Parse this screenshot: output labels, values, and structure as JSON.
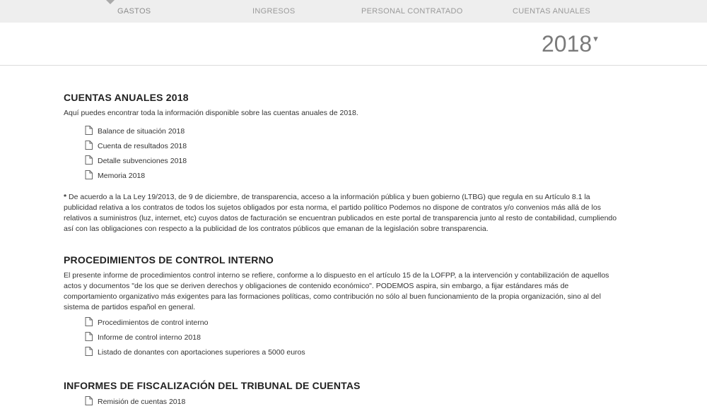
{
  "nav": {
    "tabs": [
      {
        "label": "GASTOS",
        "active": true
      },
      {
        "label": "INGRESOS",
        "active": false
      },
      {
        "label": "PERSONAL CONTRATADO",
        "active": false
      },
      {
        "label": "CUENTAS ANUALES",
        "active": false
      }
    ]
  },
  "year_selector": {
    "value": "2018",
    "chevron": "▾"
  },
  "sections": {
    "cuentas": {
      "title": "CUENTAS ANUALES 2018",
      "intro": "Aquí puedes encontrar toda la información disponible sobre las cuentas anuales de 2018.",
      "docs": [
        "Balance de situación 2018",
        "Cuenta de resultados 2018",
        "Detalle subvenciones 2018",
        "Memoria 2018"
      ],
      "note_marker": "*",
      "note": "De acuerdo a la La Ley 19/2013, de 9 de diciembre, de transparencia, acceso a la información pública y buen gobierno (LTBG) que regula en su Artículo 8.1 la publicidad relativa a los contratos de todos los sujetos obligados por esta norma, el partido político Podemos no dispone de contratos y/o convenios más allá de los relativos a suministros (luz, internet, etc) cuyos datos de facturación se encuentran publicados en este portal de transparencia junto al resto de contabilidad, cumpliendo así con las obligaciones con respecto a la publicidad de los contratos públicos que emanan de la legislación sobre transparencia."
    },
    "control": {
      "title": "PROCEDIMIENTOS DE CONTROL INTERNO",
      "intro": "El presente informe de procedimientos control interno se refiere, conforme a lo dispuesto en el artículo 15 de la LOFPP, a la intervención y contabilización de aquellos actos y documentos \"de los que se deriven derechos y obligaciones de contenido económico\". PODEMOS aspira, sin embargo, a fijar estándares más de comportamiento organizativo más exigentes para las formaciones políticas, como contribución no sólo al buen funcionamiento de la propia organización, sino al del sistema de partidos español en general.",
      "docs": [
        "Procedimientos de control interno",
        "Informe de control interno 2018",
        "Listado de donantes con aportaciones superiores a 5000 euros"
      ]
    },
    "fiscalizacion": {
      "title": "INFORMES DE FISCALIZACIÓN DEL TRIBUNAL DE CUENTAS",
      "docs": [
        "Remisión de cuentas 2018"
      ]
    }
  },
  "icons": {
    "document": "document-icon",
    "caret": "active-tab-caret"
  },
  "colors": {
    "nav_bg": "#eeeeee",
    "nav_text": "#9a9a9a",
    "year_text": "#7a7a7a",
    "heading": "#222222",
    "body_text": "#333333"
  }
}
